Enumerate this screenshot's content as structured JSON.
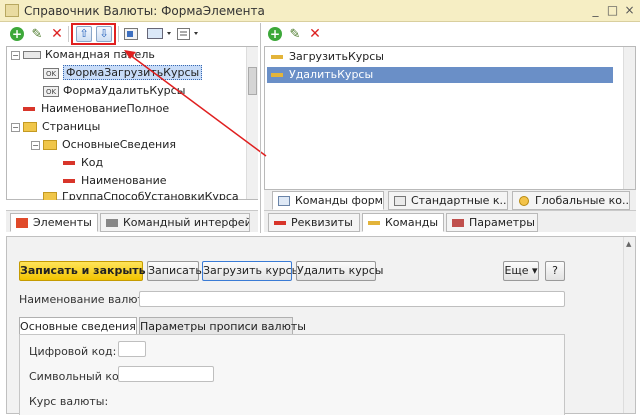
{
  "window": {
    "title": "Справочник Валюты: ФормаЭлемента",
    "btn_min": "_",
    "btn_max": "□",
    "btn_close": "×"
  },
  "left_toolbar": {
    "add": "+",
    "edit": "✎",
    "delete": "✕",
    "up": "⇧",
    "down": "⇩"
  },
  "left_tree": {
    "items": [
      {
        "label": "Командная панель"
      },
      {
        "label": "ФормаЗагрузитьКурсы",
        "icon_text": "OK"
      },
      {
        "label": "ФормаУдалитьКурсы",
        "icon_text": "OK"
      },
      {
        "label": "НаименованиеПолное"
      },
      {
        "label": "Страницы"
      },
      {
        "label": "ОсновныеСведения"
      },
      {
        "label": "Код"
      },
      {
        "label": "Наименование"
      },
      {
        "label": "ГруппаСпособУстановкиКурса"
      }
    ]
  },
  "left_tabs": [
    {
      "label": "Элементы"
    },
    {
      "label": "Командный интерфейс"
    }
  ],
  "right_toolbar": {
    "add": "+",
    "edit": "✎",
    "delete": "✕"
  },
  "right_list": {
    "items": [
      {
        "label": "ЗагрузитьКурсы"
      },
      {
        "label": "УдалитьКурсы"
      }
    ]
  },
  "right_subtabs": [
    {
      "label": "Команды формы"
    },
    {
      "label": "Стандартные к..."
    },
    {
      "label": "Глобальные ко..."
    }
  ],
  "right_tabs": [
    {
      "label": "Реквизиты"
    },
    {
      "label": "Команды"
    },
    {
      "label": "Параметры"
    }
  ],
  "form": {
    "buttons": {
      "save_close": "Записать и закрыть",
      "save": "Записать",
      "load_rates": "Загрузить курсы",
      "delete_rates": "Удалить курсы",
      "more": "Еще",
      "help": "?"
    },
    "name_label": "Наименование валюты:",
    "tabs": [
      {
        "label": "Основные сведения"
      },
      {
        "label": "Параметры прописи валюты"
      }
    ],
    "digit_code_label": "Цифровой код:",
    "symbol_code_label": "Символьный код:",
    "rate_label": "Курс валюты:"
  },
  "colors": {
    "accent_red": "#e02020",
    "selection": "#6a8fc7",
    "title_bg": "#f6eec4"
  }
}
